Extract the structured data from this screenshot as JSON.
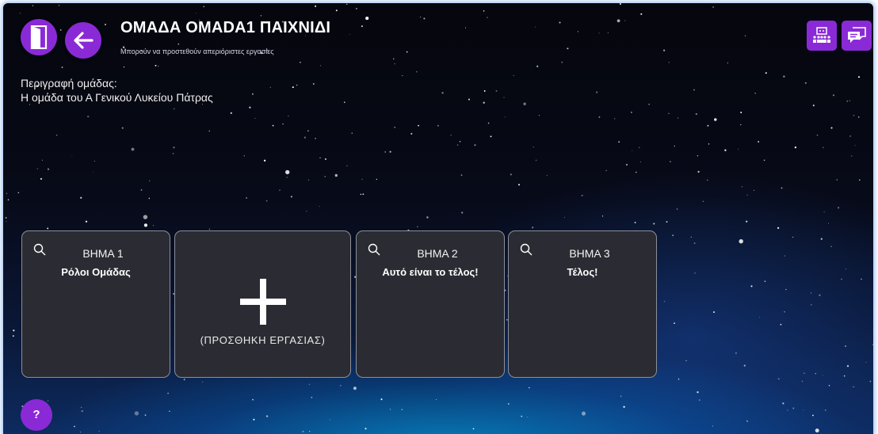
{
  "header": {
    "title": "ΟΜΑΔΑ OMADA1 ΠΑΙΧΝΙΔΙ",
    "subtitle": "Μπορούν να προστεθούν απεριόριστες εργασίες",
    "exit_icon": "door-icon",
    "back_icon": "arrow-left-icon"
  },
  "description": {
    "label": "Περιγραφή ομάδας:",
    "text": "Η ομάδα του Α Γενικού Λυκείου Πάτρας"
  },
  "toolbar": {
    "team_icon": "team-board-icon",
    "chat_icon": "chat-icon"
  },
  "cards": [
    {
      "step": "ΒΗΜΑ 1",
      "name": "Ρόλοι Ομάδας"
    },
    {
      "step": "ΒΗΜΑ 2",
      "name": "Αυτό είναι το τέλος!"
    },
    {
      "step": "ΒΗΜΑ 3",
      "name": "Τέλος!"
    }
  ],
  "add_card": {
    "label": "(ΠΡΟΣΘΗΚΗ ΕΡΓΑΣΙΑΣ)"
  },
  "help": {
    "label": "?"
  },
  "colors": {
    "accent": "#8a2ad6",
    "card_bg": "#2b2c33",
    "card_border": "#8d8f98"
  }
}
